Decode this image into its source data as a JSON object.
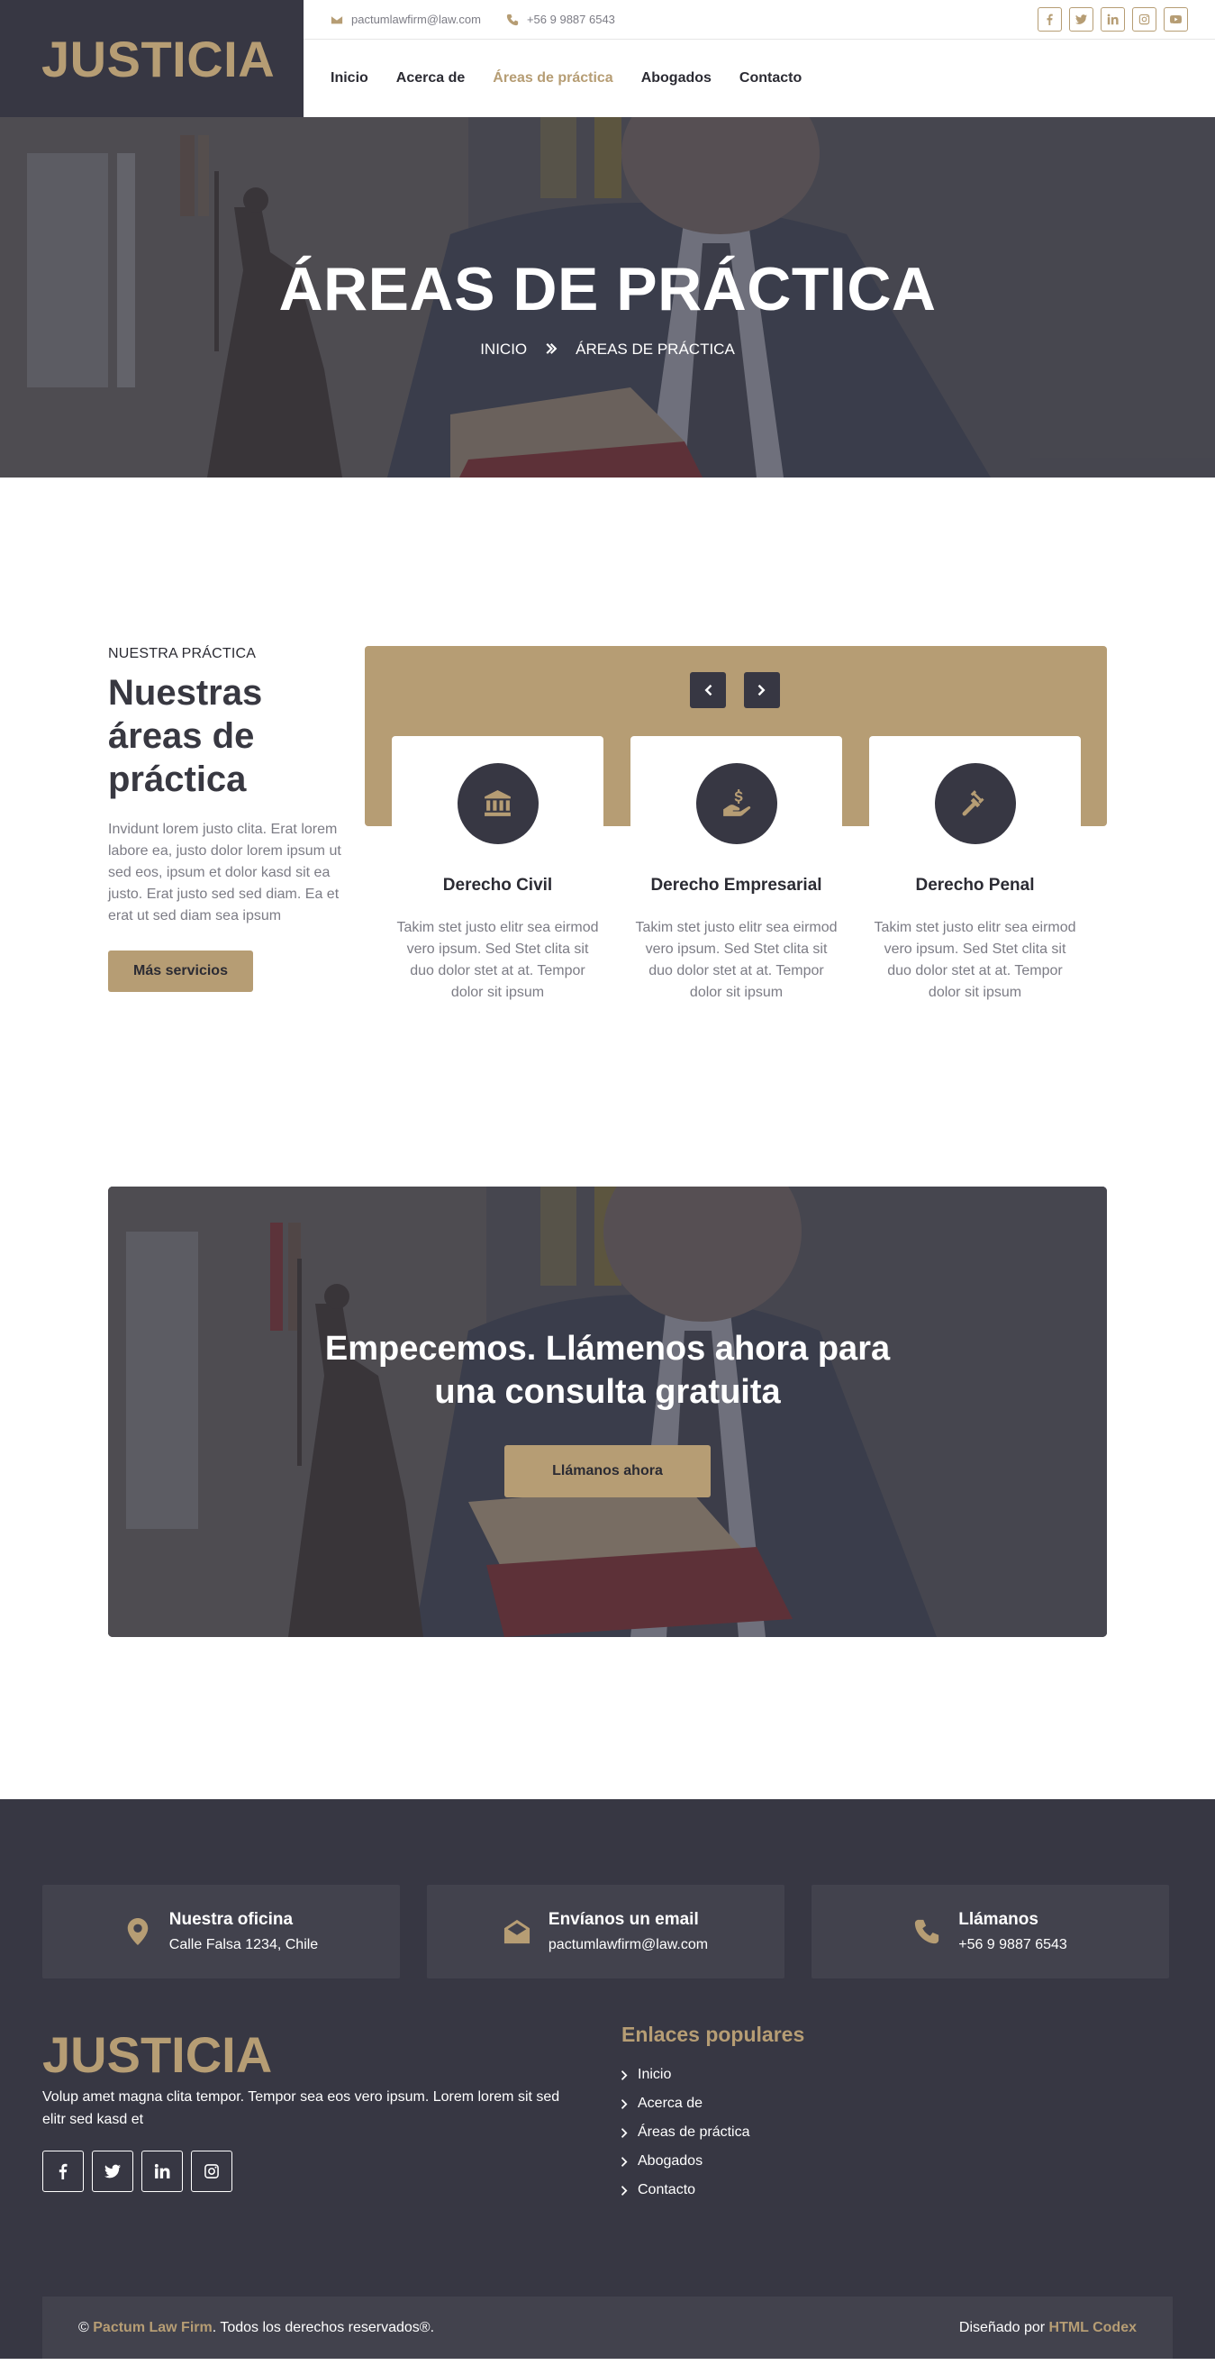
{
  "header": {
    "brand": "JUSTICIA",
    "topbar": {
      "email": "pactumlawfirm@law.com",
      "phone": "+56 9 9887 6543",
      "socials": [
        "facebook-icon",
        "twitter-icon",
        "linkedin-icon",
        "instagram-icon",
        "youtube-icon"
      ]
    },
    "nav": [
      {
        "label": "Inicio",
        "active": false
      },
      {
        "label": "Acerca de",
        "active": false
      },
      {
        "label": "Áreas de práctica",
        "active": true
      },
      {
        "label": "Abogados",
        "active": false
      },
      {
        "label": "Contacto",
        "active": false
      }
    ]
  },
  "hero": {
    "title": "ÁREAS DE PRÁCTICA",
    "breadcrumb": [
      "INICIO",
      "ÁREAS DE PRÁCTICA"
    ]
  },
  "practice": {
    "eyebrow": "NUESTRA PRÁCTICA",
    "title": "Nuestras áreas de práctica",
    "text": "Invidunt lorem justo clita. Erat lorem labore ea, justo dolor lorem ipsum ut sed eos, ipsum et dolor kasd sit ea justo. Erat justo sed sed diam. Ea et erat ut sed diam sea ipsum",
    "button": "Más servicios",
    "cards": [
      {
        "icon": "courthouse-icon",
        "title": "Derecho Civil",
        "text": "Takim stet justo elitr sea eirmod vero ipsum. Sed Stet clita sit duo dolor stet at at. Tempor dolor sit ipsum"
      },
      {
        "icon": "hand-dollar-icon",
        "title": "Derecho Empresarial",
        "text": "Takim stet justo elitr sea eirmod vero ipsum. Sed Stet clita sit duo dolor stet at at. Tempor dolor sit ipsum"
      },
      {
        "icon": "gavel-icon",
        "title": "Derecho Penal",
        "text": "Takim stet justo elitr sea eirmod vero ipsum. Sed Stet clita sit duo dolor stet at at. Tempor dolor sit ipsum"
      }
    ]
  },
  "cta": {
    "title": "Empecemos. Llámenos ahora para una consulta gratuita",
    "button": "Llámanos ahora"
  },
  "footer": {
    "info": [
      {
        "icon": "map-marker-icon",
        "label": "Nuestra oficina",
        "value": "Calle Falsa 1234, Chile"
      },
      {
        "icon": "envelope-open-icon",
        "label": "Envíanos un email",
        "value": "pactumlawfirm@law.com"
      },
      {
        "icon": "phone-icon",
        "label": "Llámanos",
        "value": "+56 9 9887 6543"
      }
    ],
    "brand": "JUSTICIA",
    "text": "Volup amet magna clita tempor. Tempor sea eos vero ipsum. Lorem lorem sit sed elitr sed kasd et",
    "socials": [
      "facebook-icon",
      "twitter-icon",
      "linkedin-icon",
      "instagram-icon"
    ],
    "links_title": "Enlaces populares",
    "links": [
      "Inicio",
      "Acerca de",
      "Áreas de práctica",
      "Abogados",
      "Contacto"
    ],
    "copyright": {
      "prefix": "©",
      "firm": "Pactum Law Firm",
      "suffix": ". Todos los derechos reservados®.",
      "designed_by": "Diseñado por",
      "designer": "HTML Codex"
    }
  },
  "colors": {
    "gold": "#b69d74",
    "dark": "#373743",
    "dark_box": "#42424d",
    "text_muted": "#7c7c85"
  }
}
